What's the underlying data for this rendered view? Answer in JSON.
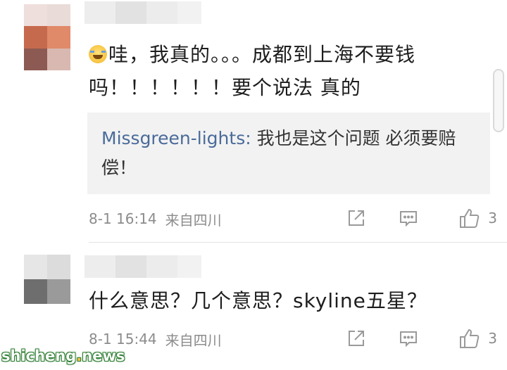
{
  "comments": [
    {
      "text": "哇，我真的。。。成都到上海不要钱吗！！！！！！要个说法 真的",
      "emoji_icon": "laughing-crying-emoji-icon",
      "reply": {
        "author": "Missgreen-lights:",
        "text": " 我也是这个问题 必须要赔偿！"
      },
      "time": "8-1 16:14",
      "source": "来自四川",
      "likes": "3"
    },
    {
      "text": "什么意思？几个意思？skyline五星？",
      "time": "8-1 15:44",
      "source": "来自四川",
      "likes": "3"
    }
  ],
  "avatar_colors": {
    "avatar1": [
      "#efdfdc",
      "#e9dbd8",
      "#c66a4e",
      "#e08a6a",
      "#8c5a52",
      "#d8b8b0"
    ],
    "avatar2": [
      "#e6e6e6",
      "#dcdcdc",
      "#6e6e6e",
      "#9a9a9a"
    ],
    "name_blur": [
      "#ededed",
      "#e2e2e2",
      "#ececec",
      "#f2f2f2"
    ]
  },
  "watermark": {
    "prefix": "shicheng",
    "dot": ".",
    "suffix": "news"
  }
}
